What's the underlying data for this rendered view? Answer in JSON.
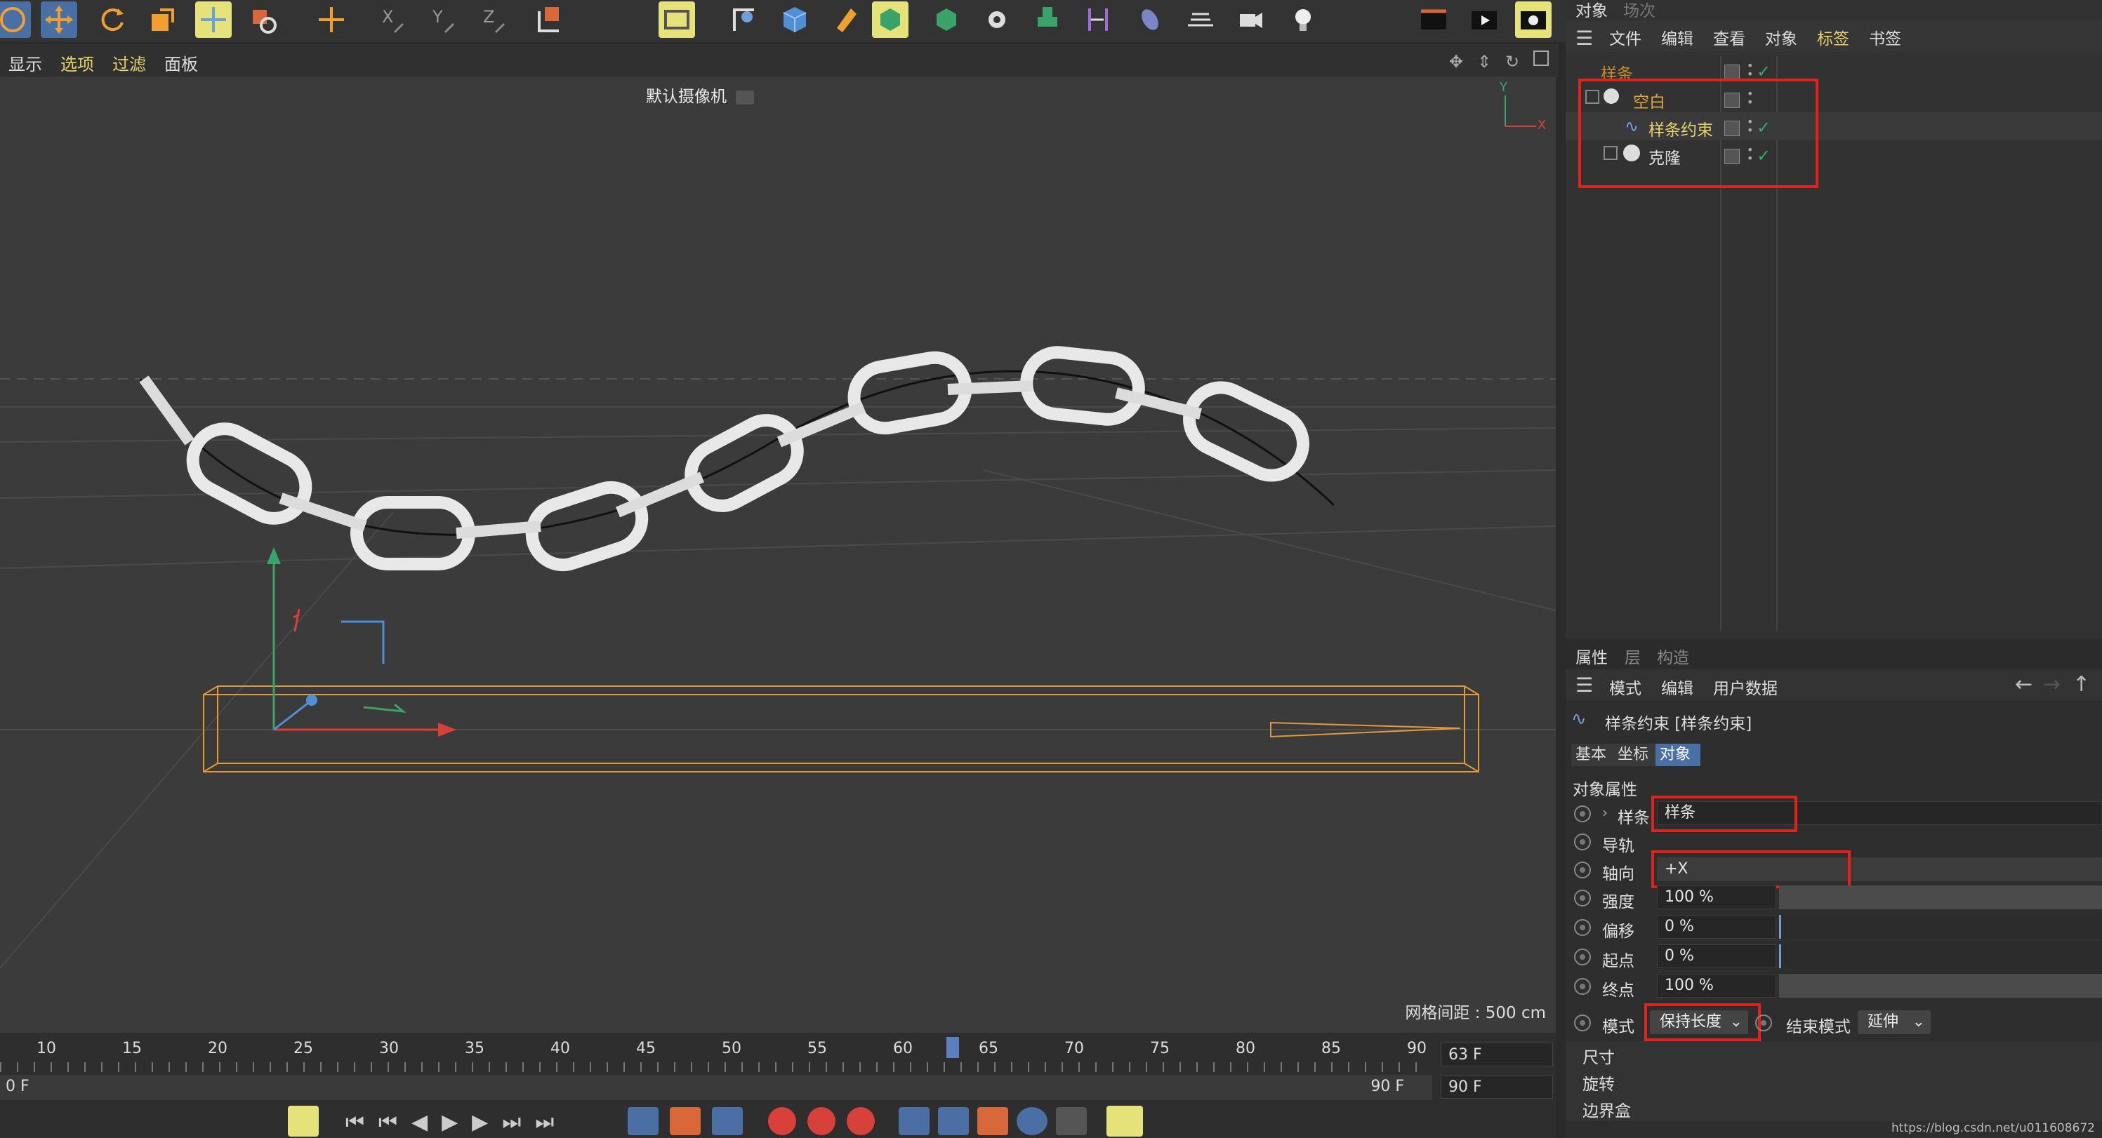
{
  "viewport_menu": {
    "display": "显示",
    "options": "选项",
    "filter": "过滤",
    "panel": "面板"
  },
  "viewport": {
    "camera": "默认摄像机",
    "grid_spacing": "网格间距 : 500 cm",
    "axis_y": "Y",
    "axis_x": "X"
  },
  "timeline": {
    "ticks": [
      "10",
      "15",
      "20",
      "25",
      "30",
      "35",
      "40",
      "45",
      "50",
      "55",
      "60",
      "65",
      "70",
      "75",
      "80",
      "85",
      "90"
    ],
    "current_frame": "63 F",
    "start_frame": "0 F",
    "end_frame_label": "90 F",
    "end_frame_field": "90 F"
  },
  "object_panel": {
    "tabs": [
      "对象",
      "场次"
    ],
    "menus": [
      "文件",
      "编辑",
      "查看",
      "对象",
      "标签",
      "书签"
    ],
    "objects": [
      {
        "name": "样条"
      },
      {
        "name": "空白"
      },
      {
        "name": "样条约束"
      },
      {
        "name": "克隆"
      }
    ]
  },
  "attr_panel": {
    "tabs": [
      "属性",
      "层",
      "构造"
    ],
    "menus": [
      "模式",
      "编辑",
      "用户数据"
    ],
    "title": "样条约束 [样条约束]",
    "subtabs": [
      "基本",
      "坐标",
      "对象"
    ],
    "section": "对象属性",
    "fields": {
      "spline": {
        "label": "样条",
        "value": "样条"
      },
      "rail": {
        "label": "导轨"
      },
      "axis": {
        "label": "轴向",
        "value": "+X"
      },
      "strength": {
        "label": "强度",
        "value": "100 %"
      },
      "offset": {
        "label": "偏移",
        "value": "0 %"
      },
      "start": {
        "label": "起点",
        "value": "0 %"
      },
      "end": {
        "label": "终点",
        "value": "100 %"
      },
      "mode": {
        "label": "模式",
        "value": "保持长度"
      },
      "end_mode": {
        "label": "结束模式",
        "value": "延伸"
      }
    },
    "collapsed_sections": [
      "尺寸",
      "旋转",
      "边界盒"
    ]
  },
  "watermark": "https://blog.csdn.net/u011608672"
}
